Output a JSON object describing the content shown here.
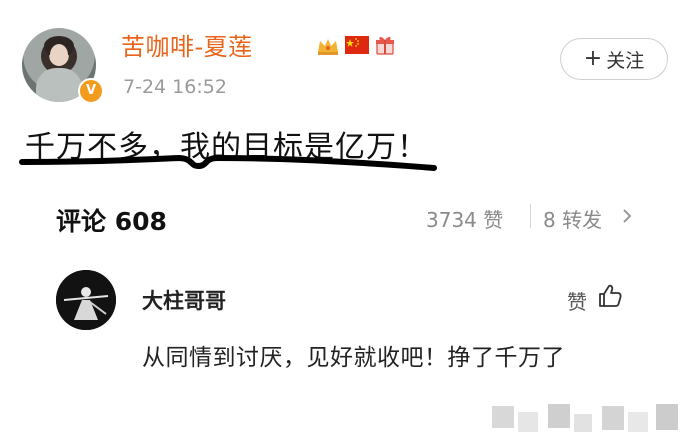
{
  "post": {
    "author": "苦咖啡-夏莲",
    "time": "7-24 16:52",
    "verified_badge": "V",
    "follow_label": "关注",
    "follow_icon": "plus-icon",
    "text": "千万不多，我的目标是亿万！",
    "underline_color": "#000000"
  },
  "stats": {
    "comments_label": "评论 608",
    "likes": "3734 赞",
    "reposts": "8 转发",
    "chevron_icon": "chevron-right-icon"
  },
  "comment": {
    "author": "大柱哥哥",
    "like_label": "赞",
    "like_icon": "thumbs-up-icon",
    "text": "从同情到讨厌，见好就收吧！挣了千万了"
  },
  "colors": {
    "username": "#e8641a",
    "muted": "#9a9a9a",
    "badge": "#f39b1c"
  }
}
